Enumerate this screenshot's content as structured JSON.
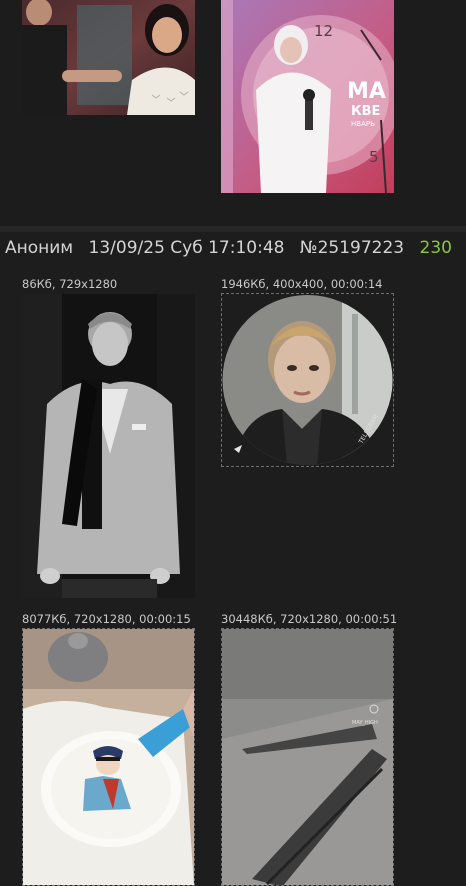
{
  "post": {
    "author": "Аноним",
    "date": "13/09/25 Суб 17:10:48",
    "number": "№25197223",
    "replies": "230"
  },
  "files": [
    {
      "meta": "86Кб, 729x1280",
      "icon": "portrait-photo"
    },
    {
      "meta": "1946Кб, 400x400, 00:00:14",
      "icon": "round-video",
      "watermark": "TELEGRAM"
    },
    {
      "meta": "8077Кб, 720x1280, 00:00:15",
      "icon": "cake-video"
    },
    {
      "meta": "30448Кб, 720x1280, 00:00:51",
      "icon": "road-video",
      "watermark": "MAY_HIGH"
    }
  ],
  "prev_post": {
    "thumbs": [
      {
        "icon": "party-photo"
      },
      {
        "icon": "clock-stage-photo",
        "text": "МА\nКВЕ\nНВАРЬ",
        "clock_number": "12"
      }
    ]
  }
}
